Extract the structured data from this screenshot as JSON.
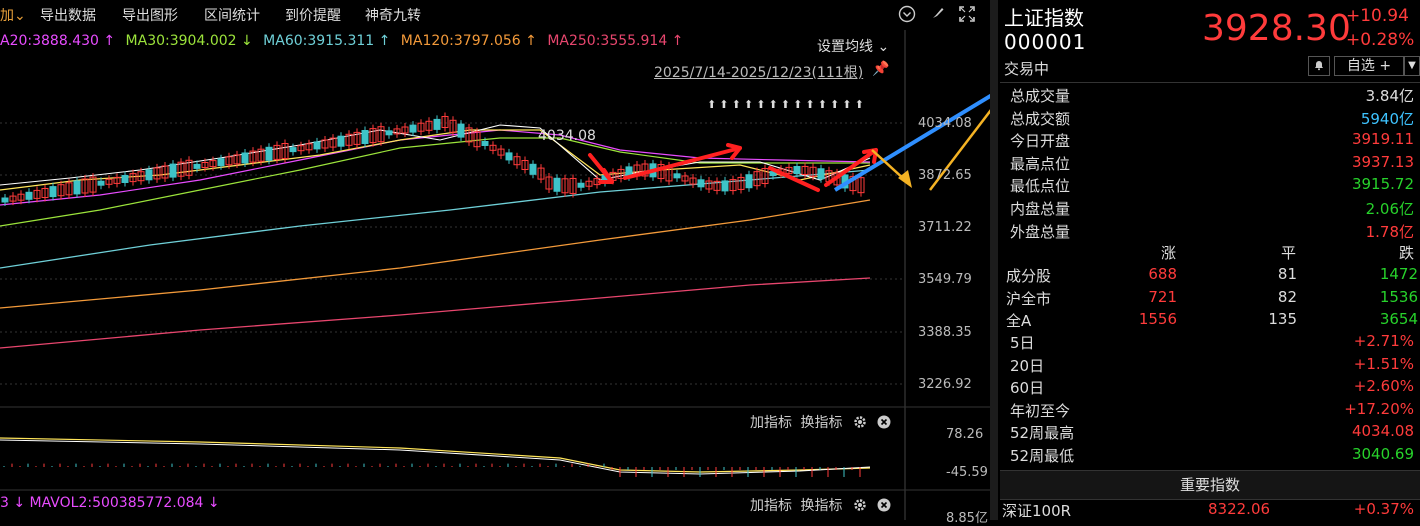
{
  "toolbar": {
    "items": [
      "加",
      "导出数据",
      "导出图形",
      "区间统计",
      "到价提醒",
      "神奇九转"
    ]
  },
  "ma": {
    "ma20": "A20:3888.430 ↑",
    "ma30": "MA30:3904.002 ↓",
    "ma60": "MA60:3915.311 ↑",
    "ma120": "MA120:3797.056 ↑",
    "ma250": "MA250:3555.914 ↑",
    "settings_label": "设置均线 ⌄"
  },
  "date_range": "2025/7/14-2025/12/23(111根)",
  "peak_label": "4034.08",
  "y_ticks": [
    "4034.08",
    "3872.65",
    "3711.22",
    "3549.79",
    "3388.35",
    "3226.92"
  ],
  "sub_ticks": [
    "78.26",
    "-45.59",
    "8.85亿"
  ],
  "sub_tools": {
    "add": "加指标",
    "change": "换指标"
  },
  "mavol": "3 ↓  MAVOL2:500385772.084 ↓",
  "index": {
    "name": "上证指数",
    "code": "000001",
    "status": "交易中",
    "price": "3928.30",
    "change": "+10.94",
    "pct": "+0.28%",
    "watch_label": "自选 +"
  },
  "stats": [
    {
      "label": "总成交量",
      "value": "3.84亿",
      "color": "white"
    },
    {
      "label": "总成交额",
      "value": "5940亿",
      "color": "cyan"
    },
    {
      "label": "今日开盘",
      "value": "3919.11",
      "color": "red"
    },
    {
      "label": "最高点位",
      "value": "3937.13",
      "color": "red"
    },
    {
      "label": "最低点位",
      "value": "3915.72",
      "color": "green"
    },
    {
      "label": "内盘总量",
      "value": "2.06亿",
      "color": "green"
    },
    {
      "label": "外盘总量",
      "value": "1.78亿",
      "color": "red"
    }
  ],
  "breadth": {
    "headers": [
      "涨",
      "平",
      "跌"
    ],
    "rows": [
      {
        "label": "成分股",
        "up": "688",
        "flat": "81",
        "down": "1472"
      },
      {
        "label": "沪全市",
        "up": "721",
        "flat": "82",
        "down": "1536"
      },
      {
        "label": "全A",
        "up": "1556",
        "flat": "135",
        "down": "3654"
      }
    ]
  },
  "perf": [
    {
      "label": "5日",
      "value": "+2.71%",
      "color": "red"
    },
    {
      "label": "20日",
      "value": "+1.51%",
      "color": "red"
    },
    {
      "label": "60日",
      "value": "+2.60%",
      "color": "red"
    },
    {
      "label": "年初至今",
      "value": "+17.20%",
      "color": "red"
    },
    {
      "label": "52周最高",
      "value": "4034.08",
      "color": "red"
    },
    {
      "label": "52周最低",
      "value": "3040.69",
      "color": "green"
    }
  ],
  "important": {
    "title": "重要指数",
    "row": {
      "name": "深证100R",
      "price": "8322.06",
      "pct": "+0.37%"
    }
  },
  "colors": {
    "up": "#ff3b3b",
    "down": "#27d22b",
    "cyan": "#3ec3ff",
    "bg": "#000000"
  }
}
